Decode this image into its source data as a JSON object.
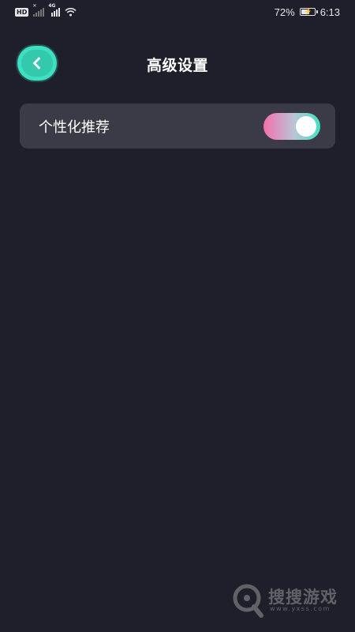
{
  "status_bar": {
    "hd_badge": "HD",
    "network_tag": "4G",
    "battery_percent": "72%",
    "battery_level": 0.72,
    "time": "6:13"
  },
  "header": {
    "title": "高级设置",
    "back_icon": "chevron-left-icon",
    "accent_color": "#3fe0c2"
  },
  "settings": {
    "items": [
      {
        "label": "个性化推荐",
        "enabled": true
      }
    ],
    "toggle_gradient": [
      "#f46fae",
      "#3fe0c2"
    ]
  },
  "watermark": {
    "text": "搜搜游戏",
    "sub": "www.yxss.com"
  },
  "colors": {
    "background": "#1e1f2a",
    "card": "#3a3b46"
  }
}
